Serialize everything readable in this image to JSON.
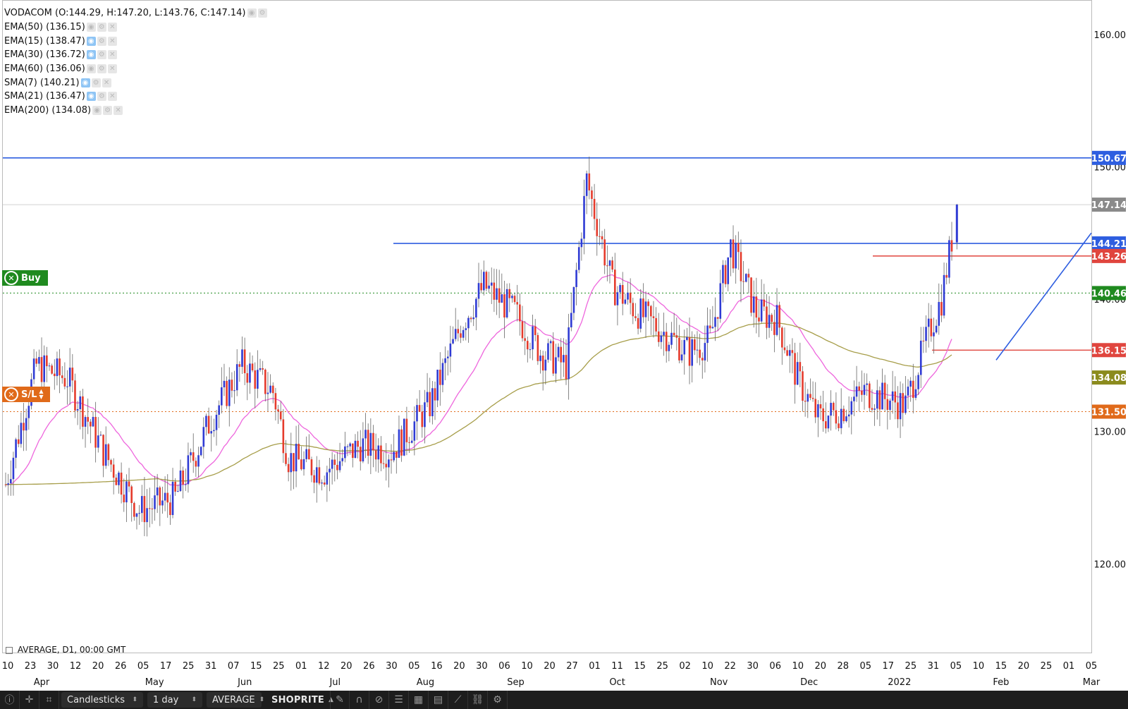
{
  "legend": [
    {
      "text": "VODACOM (O:144.29, H:147.20, L:143.76, C:147.14)",
      "eye_active": false
    },
    {
      "text": "EMA(50) (136.15)",
      "eye_active": false
    },
    {
      "text": "EMA(15) (138.47)",
      "eye_active": true
    },
    {
      "text": "EMA(30) (136.72)",
      "eye_active": true
    },
    {
      "text": "EMA(60) (136.06)",
      "eye_active": false
    },
    {
      "text": "SMA(7) (140.21)",
      "eye_active": true
    },
    {
      "text": "SMA(21) (136.47)",
      "eye_active": true
    },
    {
      "text": "EMA(200) (134.08)",
      "eye_active": false
    }
  ],
  "price_axis": {
    "ticks": [
      "160.00",
      "150.00",
      "140.00",
      "130.00",
      "120.00"
    ],
    "range": [
      113.3,
      162.6
    ]
  },
  "price_tags": [
    {
      "label": "150.67",
      "value": 150.67,
      "color": "#2e5ee0"
    },
    {
      "label": "147.14",
      "value": 147.14,
      "color": "#8a8a8a"
    },
    {
      "label": "144.21",
      "value": 144.21,
      "color": "#2e5ee0"
    },
    {
      "label": "143.26",
      "value": 143.26,
      "color": "#e0453e"
    },
    {
      "label": "140.46",
      "value": 140.46,
      "color": "#1f8a1f"
    },
    {
      "label": "136.15",
      "value": 136.15,
      "color": "#e0453e"
    },
    {
      "label": "134.08",
      "value": 134.08,
      "color": "#8b8b1e"
    },
    {
      "label": "131.50",
      "value": 131.5,
      "color": "#e06a1a"
    }
  ],
  "trade_markers": {
    "buy": {
      "label": "Buy",
      "value": 140.46,
      "color": "#1f8a1f"
    },
    "stop_loss": {
      "label": "S/L",
      "value": 131.5,
      "color": "#e06a1a"
    }
  },
  "date_axis": {
    "days": [
      "10",
      "23",
      "30",
      "12",
      "20",
      "26",
      "05",
      "17",
      "25",
      "31",
      "07",
      "15",
      "25",
      "01",
      "12",
      "20",
      "26",
      "30",
      "05",
      "16",
      "20",
      "30",
      "06",
      "10",
      "20",
      "27",
      "01",
      "11",
      "15",
      "25",
      "02",
      "10",
      "22",
      "30",
      "06",
      "10",
      "20",
      "28",
      "05",
      "17",
      "25",
      "31",
      "05",
      "10",
      "15",
      "20",
      "25",
      "01",
      "05"
    ],
    "months": [
      "Apr",
      "May",
      "Jun",
      "Jul",
      "Aug",
      "Sep",
      "Oct",
      "Nov",
      "Dec",
      "2022",
      "Feb",
      "Mar"
    ]
  },
  "status_text": "AVERAGE, D1, 00:00 GMT",
  "toolbar": {
    "chart_type": "Candlesticks",
    "timeframe": "1 day",
    "price_type": "AVERAGE",
    "symbol": "SHOPRITE"
  },
  "colors": {
    "bull": "#2f3bd4",
    "bear": "#e53b2c",
    "ema_pink": "#ee66dd",
    "ema_olive": "#a79e4a"
  },
  "chart_data": {
    "type": "candlestick",
    "symbol": "VODACOM",
    "timeframe": "D1",
    "y_range": [
      113.3,
      162.6
    ],
    "ohlc_key_points": [
      {
        "date": "2021-03-10",
        "close": 126.0
      },
      {
        "date": "2021-03-17",
        "high": 137.5,
        "close": 134.5
      },
      {
        "date": "2021-05-05",
        "low": 122.5,
        "close": 124.0
      },
      {
        "date": "2021-06-10",
        "high": 136.5,
        "close": 134.0
      },
      {
        "date": "2021-07-01",
        "low": 125.5,
        "close": 127.0
      },
      {
        "date": "2021-08-16",
        "high": 145.5,
        "close": 141.0
      },
      {
        "date": "2021-09-24",
        "high": 151.5,
        "close": 147.5
      },
      {
        "date": "2021-10-25",
        "close": 135.0
      },
      {
        "date": "2021-11-10",
        "high": 147.5,
        "close": 143.0
      },
      {
        "date": "2021-12-10",
        "low": 130.5,
        "close": 131.5
      },
      {
        "date": "2022-01-10",
        "low": 131.5,
        "close": 132.5
      },
      {
        "date": "2022-01-31",
        "open": 144.29,
        "high": 147.2,
        "low": 143.76,
        "close": 147.14
      }
    ],
    "horizontal_lines": [
      150.67,
      144.21,
      143.26,
      140.46,
      136.15,
      131.5
    ]
  }
}
